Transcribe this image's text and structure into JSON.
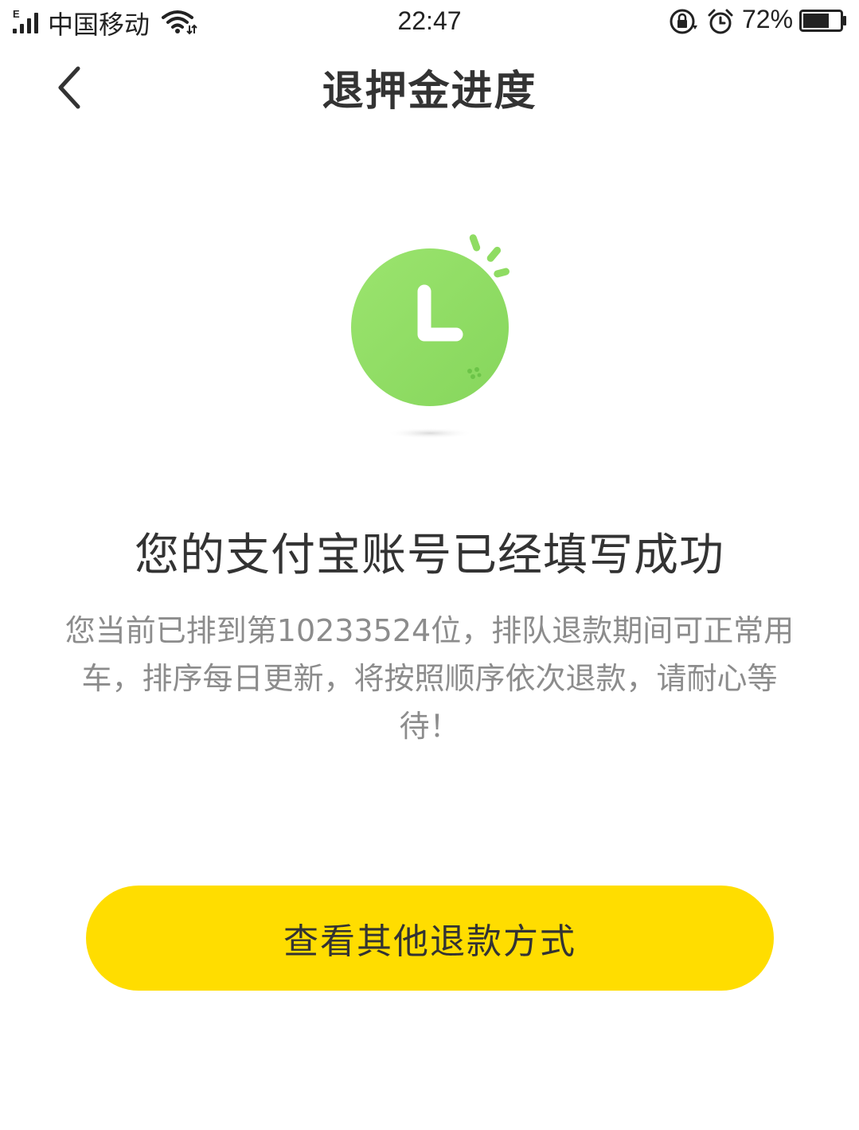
{
  "status_bar": {
    "network_type": "E",
    "carrier": "中国移动",
    "time": "22:47",
    "battery_percent": "72%",
    "battery_level": 0.72,
    "icons": [
      "signal-icon",
      "wifi-icon",
      "rotation-lock-icon",
      "alarm-icon",
      "battery-icon"
    ]
  },
  "header": {
    "back_icon": "chevron-left-icon",
    "title": "退押金进度"
  },
  "illustration": {
    "icon": "clock-icon",
    "color": "#8fdc62"
  },
  "main": {
    "headline": "您的支付宝账号已经填写成功",
    "description": "您当前已排到第10233524位，排队退款期间可正常用车，排序每日更新，将按照顺序依次退款，请耐心等待！"
  },
  "actions": {
    "other_refund_label": "查看其他退款方式"
  },
  "colors": {
    "accent": "#ffdd00",
    "success_green": "#8fdc62",
    "text_primary": "#333333",
    "text_secondary": "#8c8c8c"
  }
}
